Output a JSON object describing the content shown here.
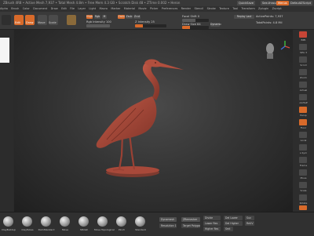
{
  "colors": {
    "accent": "#d86a2a",
    "viewport_bg": "#333333",
    "model": "#a8493a",
    "red_button": "#c74536"
  },
  "window": {
    "title": "ZBrush 4R8 • Active Mesh 7,937 • Total Mesh 4.8m • Free Mem 4.3 GB • Scratch Disk 48 • ZTime 0.002 • Heron",
    "quicksave": "QuickSave",
    "see_through": "See-through 0",
    "menus": "Menus",
    "default_script": "DefaultZScript"
  },
  "menubar": {
    "items": [
      "Alpha",
      "Brush",
      "Color",
      "Document",
      "Draw",
      "Edit",
      "File",
      "Layer",
      "Light",
      "Macro",
      "Marker",
      "Material",
      "Movie",
      "Picker",
      "Preferences",
      "Render",
      "Stencil",
      "Stroke",
      "Texture",
      "Tool",
      "Transform",
      "Zplugin",
      "Zscript"
    ]
  },
  "shelf": {
    "edit_label": "Edit",
    "draw_label": "Draw",
    "move_label": "Move",
    "scale_label": "Scale",
    "rotate_label": "Rotate",
    "mrgb": "Mrgb",
    "rgb": "Rgb",
    "m": "M",
    "zadd": "Zadd",
    "zsub": "Zsub",
    "zcut": "Zcut",
    "rgb_intensity_label": "Rgb Intensity 100",
    "z_intensity_label": "Z Intensity 25",
    "focal_shift_label": "Focal Shift 0",
    "draw_size_label": "Draw Size 64",
    "dynamic_label": "Dynamic",
    "active_points": "ActivePoints: 7,937",
    "total_points": "TotalPoints: 4.8 Mil",
    "replay_last": "Replay Last",
    "polyframe": "PolyF"
  },
  "left_panel": {
    "swatch": "Main Color"
  },
  "viewport": {
    "model_name": "Heron sculpt"
  },
  "right_panel": {
    "items": [
      "BPR",
      "SPix 3",
      "Scroll",
      "Zoom",
      "Actual",
      "AAHalf",
      "Persp",
      "Floor",
      "Local",
      "L.Sym",
      "Frame",
      "Move",
      "Scale",
      "Rotate",
      "Line Fill",
      "PolyF",
      "Transp",
      "Ghost",
      "Solo",
      "Xpose"
    ]
  },
  "bottom": {
    "brushes": [
      "ClayBuildup",
      "ClayTubes",
      "DamStandard",
      "Move",
      "hPolish",
      "Move Topological",
      "Pinch",
      "Standard"
    ],
    "buttons": [
      "Dynamesh",
      "Resolution 128",
      "ZRemesher",
      "Target Polygons 5",
      "Divide",
      "Lower Res",
      "Higher Res",
      "Del Lower",
      "Del Higher",
      "Smt",
      "Suv",
      "ReUV"
    ]
  }
}
